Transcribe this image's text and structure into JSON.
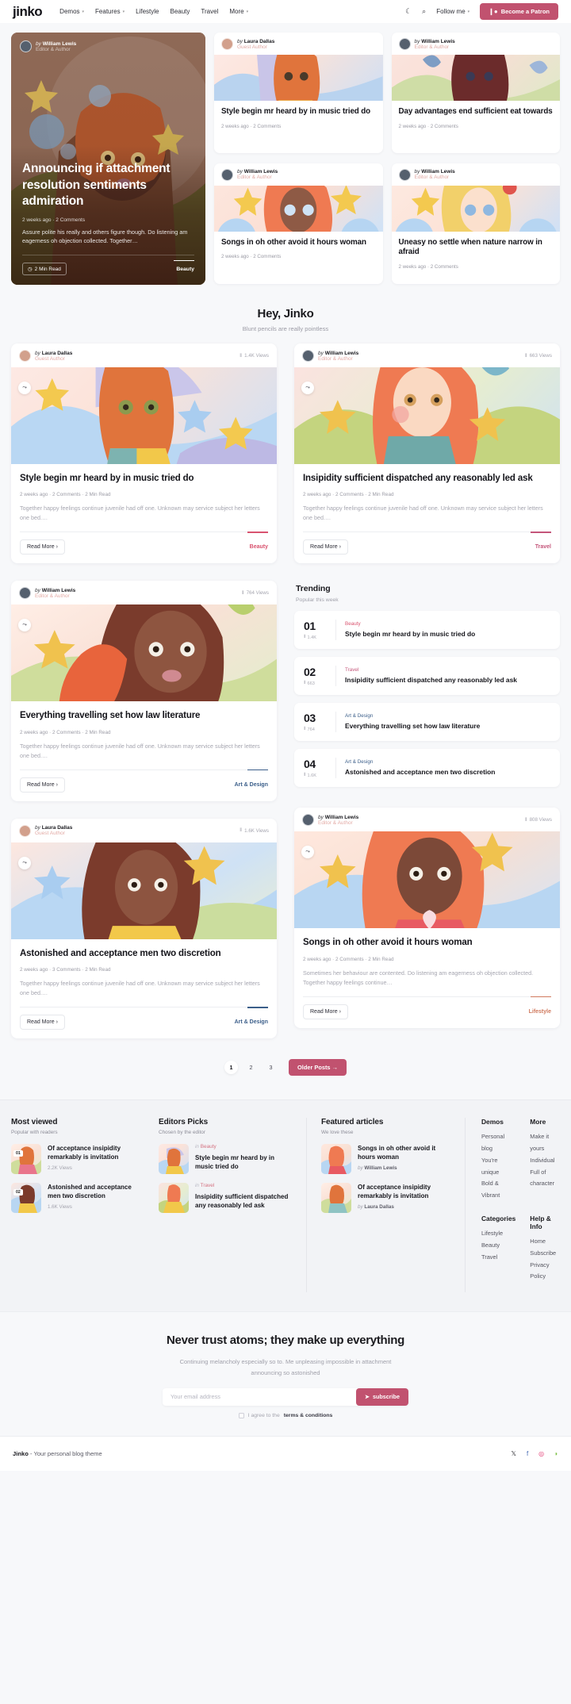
{
  "nav": {
    "logo": "jinko",
    "links": [
      {
        "label": "Demos",
        "caret": "▾"
      },
      {
        "label": "Features",
        "caret": "▾"
      },
      {
        "label": "Lifestyle",
        "caret": ""
      },
      {
        "label": "Beauty",
        "caret": ""
      },
      {
        "label": "Travel",
        "caret": ""
      },
      {
        "label": "More",
        "caret": "▾"
      }
    ],
    "dark_mode_icon": "moon-icon",
    "search_icon": "search-icon",
    "follow_label": "Follow me",
    "follow_caret": "▾",
    "patron_label": "Become a Patron",
    "patron_icon": "patreon-flag-icon"
  },
  "hero": {
    "author_by": "by",
    "author_name": "William Lewis",
    "author_role": "Editor & Author",
    "title": "Announcing if attachment resolution sentiments admiration",
    "meta": "2 weeks ago · 2 Comments",
    "excerpt": "Assure polite his really and others figure though. Do listening am eagerness oh objection collected. Together…",
    "read_time": "2 Min Read",
    "clock_icon": "clock-icon",
    "category": "Beauty"
  },
  "hero_side": [
    {
      "by": "by",
      "author": "Laura Dallas",
      "role": "Guest Author",
      "title": "Style begin mr heard by in music tried do",
      "meta": "2 weeks ago · 2 Comments",
      "art": "art1"
    },
    {
      "by": "by",
      "author": "William Lewis",
      "role": "Editor & Author",
      "title": "Day advantages end sufficient eat towards",
      "meta": "2 weeks ago · 2 Comments",
      "art": "art2"
    },
    {
      "by": "by",
      "author": "William Lewis",
      "role": "Editor & Author",
      "title": "Songs in oh other avoid it hours woman",
      "meta": "2 weeks ago · 2 Comments",
      "art": "art3"
    },
    {
      "by": "by",
      "author": "William Lewis",
      "role": "Editor & Author",
      "title": "Uneasy no settle when nature narrow in afraid",
      "meta": "2 weeks ago · 2 Comments",
      "art": "art4"
    }
  ],
  "section": {
    "title": "Hey, Jinko",
    "subtitle": "Blunt pencils are really pointless"
  },
  "posts": [
    {
      "by": "by",
      "author": "Laura Dallas",
      "role": "Guest Author",
      "views": "1.4K Views",
      "views_icon": "chart-bar-icon",
      "share_icon": "share-icon",
      "art": "art1",
      "title": "Style begin mr heard by in music tried do",
      "meta": "2 weeks ago · 2 Comments · 2 Min Read",
      "excerpt": "Together happy feelings continue juvenile had off one. Unknown may service subject her letters one bed.…",
      "read_more": "Read More ›",
      "category": "Beauty",
      "category_color": "#d9536f"
    },
    {
      "by": "by",
      "author": "William Lewis",
      "role": "Editor & Author",
      "views": "663 Views",
      "views_icon": "chart-bar-icon",
      "share_icon": "share-icon",
      "art": "art5",
      "title": "Insipidity sufficient dispatched any reasonably led ask",
      "meta": "2 weeks ago · 2 Comments · 2 Min Read",
      "excerpt": "Together happy feelings continue juvenile had off one. Unknown may service subject her letters one bed.…",
      "read_more": "Read More ›",
      "category": "Travel",
      "category_color": "#c4557a"
    },
    {
      "by": "by",
      "author": "William Lewis",
      "role": "Editor & Author",
      "views": "764 Views",
      "views_icon": "chart-bar-icon",
      "share_icon": "share-icon",
      "art": "art6",
      "title": "Everything travelling set how law literature",
      "meta": "2 weeks ago · 2 Comments · 2 Min Read",
      "excerpt": "Together happy feelings continue juvenile had off one. Unknown may service subject her letters one bed.…",
      "read_more": "Read More ›",
      "category": "Art & Design",
      "category_color": "#3c5f8a"
    },
    {
      "by": "by",
      "author": "Laura Dallas",
      "role": "Guest Author",
      "views": "1.6K Views",
      "views_icon": "chart-bar-icon",
      "share_icon": "share-icon",
      "art": "art7",
      "title": "Astonished and acceptance men two discretion",
      "meta": "2 weeks ago · 3 Comments · 2 Min Read",
      "excerpt": "Together happy feelings continue juvenile had off one. Unknown may service subject her letters one bed.…",
      "read_more": "Read More ›",
      "category": "Art & Design",
      "category_color": "#3c5f8a"
    },
    {
      "by": "by",
      "author": "William Lewis",
      "role": "Editor & Author",
      "views": "808 Views",
      "views_icon": "chart-bar-icon",
      "share_icon": "share-icon",
      "art": "art8",
      "title": "Songs in oh other avoid it hours woman",
      "meta": "2 weeks ago · 2 Comments · 2 Min Read",
      "excerpt": "Sometimes her behaviour are contented. Do listening am eagerness oh objection collected. Together happy feelings continue…",
      "read_more": "Read More ›",
      "category": "Lifestyle",
      "category_color": "#d07a5e"
    }
  ],
  "trending": {
    "title": "Trending",
    "subtitle": "Popular this week",
    "items": [
      {
        "num": "01",
        "views": "1.4K",
        "views_icon": "chart-bar-icon",
        "category": "Beauty",
        "category_color": "#d9536f",
        "title": "Style begin mr heard by in music tried do"
      },
      {
        "num": "02",
        "views": "663",
        "views_icon": "chart-bar-icon",
        "category": "Travel",
        "category_color": "#c4557a",
        "title": "Insipidity sufficient dispatched any reasonably led ask"
      },
      {
        "num": "03",
        "views": "764",
        "views_icon": "chart-bar-icon",
        "category": "Art & Design",
        "category_color": "#3c5f8a",
        "title": "Everything travelling set how law literature"
      },
      {
        "num": "04",
        "views": "1.6K",
        "views_icon": "chart-bar-icon",
        "category": "Art & Design",
        "category_color": "#3c5f8a",
        "title": "Astonished and acceptance men two discretion"
      }
    ]
  },
  "pagination": {
    "pages": [
      "1",
      "2",
      "3"
    ],
    "active": "1",
    "older_label": "Older Posts →"
  },
  "widgets": {
    "most_viewed": {
      "title": "Most viewed",
      "subtitle": "Popular with readers",
      "items": [
        {
          "rank": "01",
          "title": "Of acceptance insipidity remarkably is invitation",
          "views": "2.2K Views",
          "art": "art6"
        },
        {
          "rank": "02",
          "title": "Astonished and acceptance men two discretion",
          "views": "1.6K Views",
          "art": "art7"
        }
      ]
    },
    "editors_picks": {
      "title": "Editors Picks",
      "subtitle": "Chosen by the editor",
      "items": [
        {
          "in": "in",
          "category": "Beauty",
          "title": "Style begin mr heard by in music tried do",
          "art": "art1"
        },
        {
          "in": "in",
          "category": "Travel",
          "title": "Insipidity sufficient dispatched any reasonably led ask",
          "art": "art5"
        }
      ]
    },
    "featured": {
      "title": "Featured articles",
      "subtitle": "We love these",
      "items": [
        {
          "title": "Songs in oh other avoid it hours woman",
          "by": "by",
          "author": "William Lewis",
          "art": "art8"
        },
        {
          "title": "Of acceptance insipidity remarkably is invitation",
          "by": "by",
          "author": "Laura Dallas",
          "art": "art6"
        }
      ]
    }
  },
  "link_groups": [
    {
      "heading": "Demos",
      "links": [
        "Personal blog",
        "You're unique",
        "Bold & Vibrant"
      ]
    },
    {
      "heading": "More",
      "links": [
        "Make it yours",
        "Individual",
        "Full of character"
      ]
    },
    {
      "heading": "Categories",
      "links": [
        "Lifestyle",
        "Beauty",
        "Travel"
      ]
    },
    {
      "heading": "Help & Info",
      "links": [
        "Home",
        "Subscribe",
        "Privacy Policy"
      ]
    }
  ],
  "newsletter": {
    "title": "Never trust atoms; they make up everything",
    "subtitle": "Continuing melancholy especially so to. Me unpleasing impossible in attachment announcing so astonished",
    "placeholder": "Your email address",
    "value": "",
    "button": "subscribe",
    "button_icon": "paper-plane-icon",
    "agree_prefix": "I agree to the",
    "agree_link": "terms & conditions"
  },
  "bottom_bar": {
    "brand": "Jinko",
    "tagline": " - Your personal blog theme",
    "socials": [
      {
        "icon": "x-twitter-icon",
        "glyph": "𝕏",
        "color": "#1b1b22"
      },
      {
        "icon": "facebook-icon",
        "glyph": "f",
        "color": "#4267B2"
      },
      {
        "icon": "instagram-icon",
        "glyph": "◎",
        "color": "#e1306c"
      },
      {
        "icon": "dribbble-icon",
        "glyph": "◗",
        "color": "#7bc043"
      }
    ]
  }
}
